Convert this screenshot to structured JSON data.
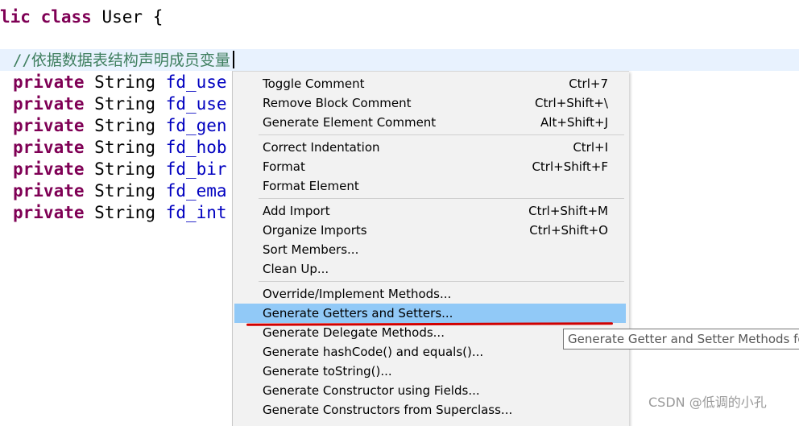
{
  "editor": {
    "class_decl": {
      "partial_keyword": "lic",
      "keyword": "class",
      "name": "User",
      "brace": "{"
    },
    "comment": "//依据数据表结构声明成员变量",
    "fields": [
      {
        "modifier": "private",
        "type": "String",
        "name": "fd_use"
      },
      {
        "modifier": "private",
        "type": "String",
        "name": "fd_use"
      },
      {
        "modifier": "private",
        "type": "String",
        "name": "fd_gen"
      },
      {
        "modifier": "private",
        "type": "String",
        "name": "fd_hob"
      },
      {
        "modifier": "private",
        "type": "String",
        "name": "fd_bir"
      },
      {
        "modifier": "private",
        "type": "String",
        "name": "fd_ema"
      },
      {
        "modifier": "private",
        "type": "String",
        "name": "fd_int"
      }
    ]
  },
  "context_menu": {
    "groups": [
      [
        {
          "label": "Toggle Comment",
          "shortcut": "Ctrl+7"
        },
        {
          "label": "Remove Block Comment",
          "shortcut": "Ctrl+Shift+\\"
        },
        {
          "label": "Generate Element Comment",
          "shortcut": "Alt+Shift+J"
        }
      ],
      [
        {
          "label": "Correct Indentation",
          "shortcut": "Ctrl+I"
        },
        {
          "label": "Format",
          "shortcut": "Ctrl+Shift+F"
        },
        {
          "label": "Format Element",
          "shortcut": ""
        }
      ],
      [
        {
          "label": "Add Import",
          "shortcut": "Ctrl+Shift+M"
        },
        {
          "label": "Organize Imports",
          "shortcut": "Ctrl+Shift+O"
        },
        {
          "label": "Sort Members...",
          "shortcut": ""
        },
        {
          "label": "Clean Up...",
          "shortcut": ""
        }
      ],
      [
        {
          "label": "Override/Implement Methods...",
          "shortcut": ""
        },
        {
          "label": "Generate Getters and Setters...",
          "shortcut": "",
          "highlighted": true
        },
        {
          "label": "Generate Delegate Methods...",
          "shortcut": ""
        },
        {
          "label": "Generate hashCode() and equals()...",
          "shortcut": ""
        },
        {
          "label": "Generate toString()...",
          "shortcut": ""
        },
        {
          "label": "Generate Constructor using Fields...",
          "shortcut": ""
        },
        {
          "label": "Generate Constructors from Superclass...",
          "shortcut": ""
        }
      ]
    ]
  },
  "tooltip": {
    "text": "Generate Getter and Setter Methods fo"
  },
  "watermark": {
    "text": "CSDN @低调的小孔"
  },
  "colors": {
    "keyword": "#7f0055",
    "field": "#0000c0",
    "comment": "#3f7f5f",
    "highlight": "#91c9f7",
    "annotation": "#d10000"
  }
}
